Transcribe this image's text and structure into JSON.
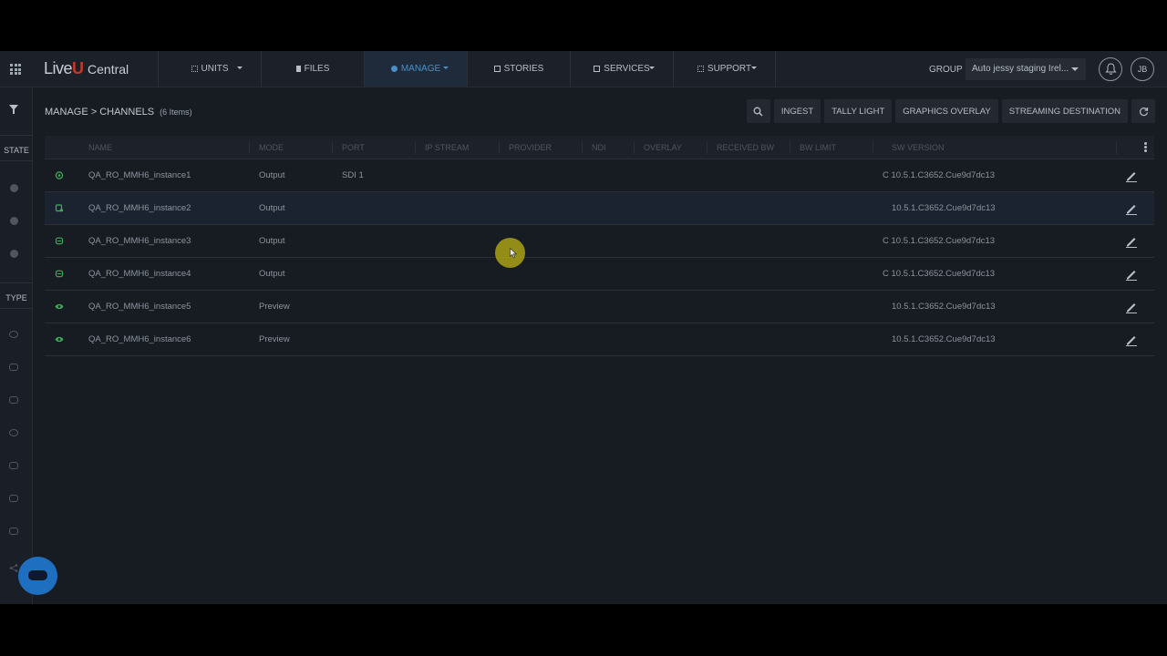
{
  "brand": {
    "live": "Live",
    "u": "U",
    "central": "Central"
  },
  "nav": {
    "items": [
      {
        "label": "UNITS",
        "icon": "grid-icon",
        "has_menu": true
      },
      {
        "label": "FILES",
        "icon": "file-icon",
        "has_menu": false
      },
      {
        "label": "MANAGE",
        "icon": "gear-icon",
        "has_menu": true,
        "active": true
      },
      {
        "label": "STORIES",
        "icon": "stories-icon",
        "has_menu": false
      },
      {
        "label": "SERVICES",
        "icon": "services-icon",
        "has_menu": true
      },
      {
        "label": "SUPPORT",
        "icon": "support-icon",
        "has_menu": true
      }
    ]
  },
  "header": {
    "group_label": "GROUP",
    "group_value": "Auto jessy staging Irel...",
    "avatar_initials": "JB"
  },
  "sidebar": {
    "state_label": "STATE",
    "type_label": "TYPE"
  },
  "main": {
    "breadcrumb": "MANAGE > CHANNELS",
    "count": "(6 Items)",
    "toolbar": {
      "ingest": "INGEST",
      "tally_light": "TALLY LIGHT",
      "graphics_overlay": "GRAPHICS OVERLAY",
      "streaming_destination": "STREAMING DESTINATION"
    }
  },
  "table": {
    "columns": [
      "NAME",
      "MODE",
      "PORT",
      "IP STREAM",
      "PROVIDER",
      "NDI",
      "OVERLAY",
      "RECEIVED BW",
      "BW LIMIT",
      "SW VERSION"
    ],
    "rows": [
      {
        "name": "QA_RO_MMH6_instance1",
        "mode": "Output",
        "port": "SDI 1",
        "sw_version": "C 10.5.1.C3652.Cue9d7dc13",
        "state_icon": "output-icon"
      },
      {
        "name": "QA_RO_MMH6_instance2",
        "mode": "Output",
        "port": "",
        "sw_version": "10.5.1.C3652.Cue9d7dc13",
        "state_icon": "output-icon"
      },
      {
        "name": "QA_RO_MMH6_instance3",
        "mode": "Output",
        "port": "",
        "sw_version": "C 10.5.1.C3652.Cue9d7dc13",
        "state_icon": "output-icon"
      },
      {
        "name": "QA_RO_MMH6_instance4",
        "mode": "Output",
        "port": "",
        "sw_version": "C 10.5.1.C3652.Cue9d7dc13",
        "state_icon": "output-icon"
      },
      {
        "name": "QA_RO_MMH6_instance5",
        "mode": "Preview",
        "port": "",
        "sw_version": "10.5.1.C3652.Cue9d7dc13",
        "state_icon": "eye-icon"
      },
      {
        "name": "QA_RO_MMH6_instance6",
        "mode": "Preview",
        "port": "",
        "sw_version": "10.5.1.C3652.Cue9d7dc13",
        "state_icon": "eye-icon"
      }
    ]
  },
  "colors": {
    "accent": "#4a90c7",
    "status_green": "#3fae5a",
    "brand_red": "#c0392b",
    "chat_blue": "#1f6fc1"
  }
}
